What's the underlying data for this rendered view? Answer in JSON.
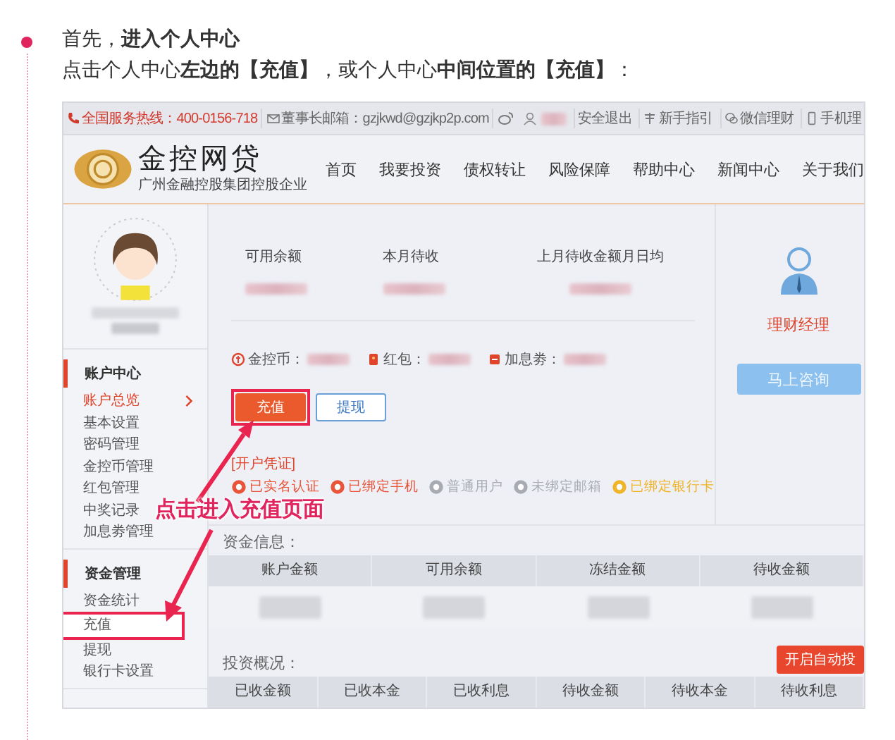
{
  "intro": {
    "line_1": "首先，**进入个人中心**",
    "line_2": "点击个人中心**左边的【充值】**，或个人中心**中间位置的【充值】**："
  },
  "screenshot": {
    "top_bar": {
      "hotline": "全国服务热线：400-0156-718",
      "email": "董事长邮箱：gzjkwd@gzjkp2p.com",
      "links": [
        {
          "label": "安全退出",
          "kind": "plain"
        },
        {
          "label": "新手指引",
          "kind": "guide"
        },
        {
          "label": "微信理财",
          "kind": "wechat"
        },
        {
          "label": "手机理",
          "kind": "mobile"
        }
      ]
    },
    "logo": {
      "name": "金控网贷",
      "tagline": "广州金融控股集团控股企业"
    },
    "nav": [
      "首页",
      "我要投资",
      "债权转让",
      "风险保障",
      "帮助中心",
      "新闻中心",
      "关于我们"
    ],
    "sidebar": [
      {
        "title": "账户中心",
        "items": [
          {
            "label": "账户总览",
            "selected": true,
            "highlighted": false
          },
          {
            "label": "基本设置",
            "selected": false,
            "highlighted": false
          },
          {
            "label": "密码管理",
            "selected": false,
            "highlighted": false
          },
          {
            "label": "金控币管理",
            "selected": false,
            "highlighted": false
          },
          {
            "label": "红包管理",
            "selected": false,
            "highlighted": false
          },
          {
            "label": "中奖记录",
            "selected": false,
            "highlighted": false
          },
          {
            "label": "加息劵管理",
            "selected": false,
            "highlighted": false
          }
        ]
      },
      {
        "title": "资金管理",
        "items": [
          {
            "label": "资金统计",
            "selected": false,
            "highlighted": false
          },
          {
            "label": "充值",
            "selected": false,
            "highlighted": true
          },
          {
            "label": "提现",
            "selected": false,
            "highlighted": false
          },
          {
            "label": "银行卡设置",
            "selected": false,
            "highlighted": false
          }
        ]
      }
    ],
    "stats": [
      "可用余额",
      "本月待收",
      "上月待收金额月日均"
    ],
    "assets": [
      {
        "label": "金控币：",
        "kind": "coin"
      },
      {
        "label": "红包：",
        "kind": "packet"
      },
      {
        "label": "加息劵：",
        "kind": "coupon"
      }
    ],
    "buttons": [
      {
        "label": "充值",
        "kind": "primary",
        "highlighted": true
      },
      {
        "label": "提现",
        "kind": "outline",
        "highlighted": false
      }
    ],
    "credentials": {
      "title": "[开户凭证]",
      "badges": [
        {
          "label": "已实名认证",
          "color": "#e8553a"
        },
        {
          "label": "已绑定手机",
          "color": "#e8553a"
        },
        {
          "label": "普通用户",
          "color": "#a9abb3"
        },
        {
          "label": "未绑定邮箱",
          "color": "#a9abb3"
        },
        {
          "label": "已绑定银行卡",
          "color": "#f0b429"
        }
      ]
    },
    "manager": {
      "title": "理财经理",
      "button": "马上咨询"
    },
    "fund_info": {
      "title": "资金信息：",
      "columns": [
        "账户金额",
        "可用余额",
        "冻结金额",
        "待收金额"
      ]
    },
    "investment": {
      "title": "投资概况：",
      "button": "开启自动投",
      "columns": [
        "已收金额",
        "已收本金",
        "已收利息",
        "待收金额",
        "待收本金",
        "待收利息"
      ]
    }
  },
  "annotation": {
    "label": "点击进入充值页面"
  }
}
